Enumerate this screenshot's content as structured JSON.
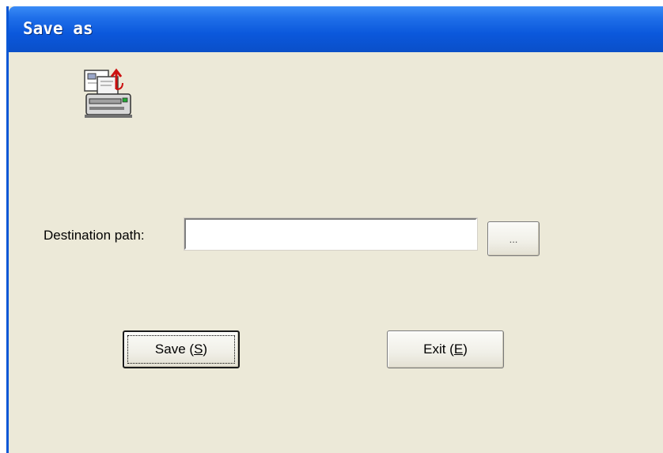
{
  "window": {
    "title": "Save as"
  },
  "icons": {
    "app": "save-printer-icon"
  },
  "form": {
    "destination_label": "Destination path:",
    "destination_value": "",
    "browse_label": "..."
  },
  "buttons": {
    "save_label_pre": "Save (",
    "save_mnemonic": "S",
    "save_label_post": ")",
    "exit_label_pre": "Exit (",
    "exit_mnemonic": "E",
    "exit_label_post": ")"
  },
  "colors": {
    "titlebar": "#0b58dc",
    "dialog_bg": "#ece9d8"
  }
}
